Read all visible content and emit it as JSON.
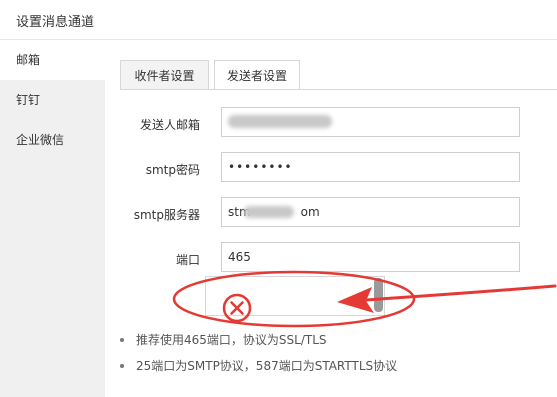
{
  "window": {
    "title": "设置消息通道"
  },
  "sidebar": {
    "items": [
      {
        "label": "邮箱"
      },
      {
        "label": "钉钉"
      },
      {
        "label": "企业微信"
      }
    ]
  },
  "tabs": [
    {
      "label": "收件者设置"
    },
    {
      "label": "发送者设置"
    }
  ],
  "form": {
    "sender_email": {
      "label": "发送人邮箱",
      "value": ""
    },
    "smtp_password": {
      "label": "smtp密码",
      "value": "••••••••"
    },
    "smtp_server": {
      "label": "smtp服务器",
      "value_prefix": "stm",
      "value_suffix": "om"
    },
    "port": {
      "label": "端口",
      "value": "465"
    }
  },
  "notes": [
    "推荐使用465端口，协议为SSL/TLS",
    "25端口为SMTP协议，587端口为STARTTLS协议"
  ],
  "colors": {
    "annotation": "#e53935",
    "active_bg": "#ffffff",
    "sidebar_bg": "#f0f0f0"
  }
}
